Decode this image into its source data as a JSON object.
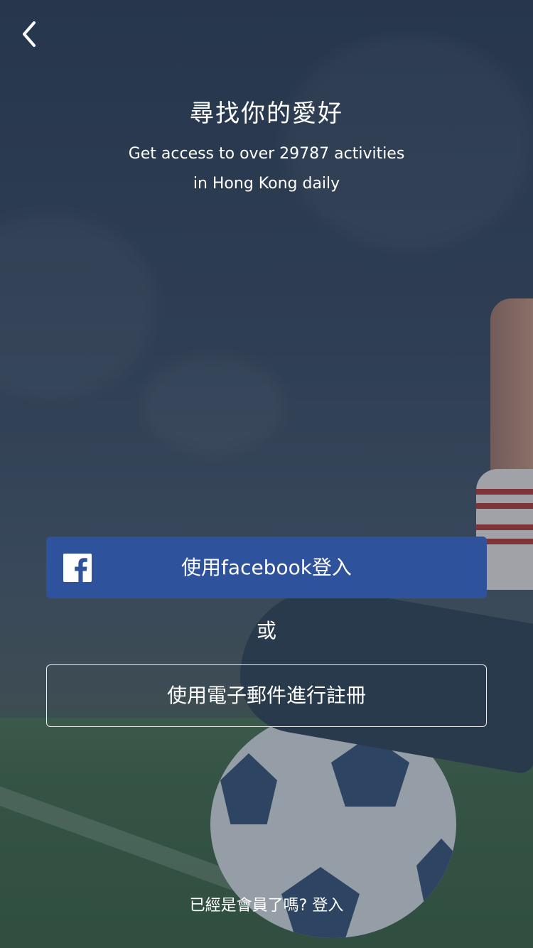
{
  "header": {
    "back_icon": "chevron-left-icon",
    "title": "尋找你的愛好",
    "subtitle_line1": "Get access to over 29787 activities",
    "subtitle_line2": "in Hong Kong daily"
  },
  "actions": {
    "facebook_label": "使用facebook登入",
    "facebook_icon": "facebook-icon",
    "facebook_color": "#2f529d",
    "or_label": "或",
    "email_label": "使用電子郵件進行註冊"
  },
  "footer": {
    "member_prompt": "已經是會員了嗎?",
    "login_link": "登入"
  }
}
